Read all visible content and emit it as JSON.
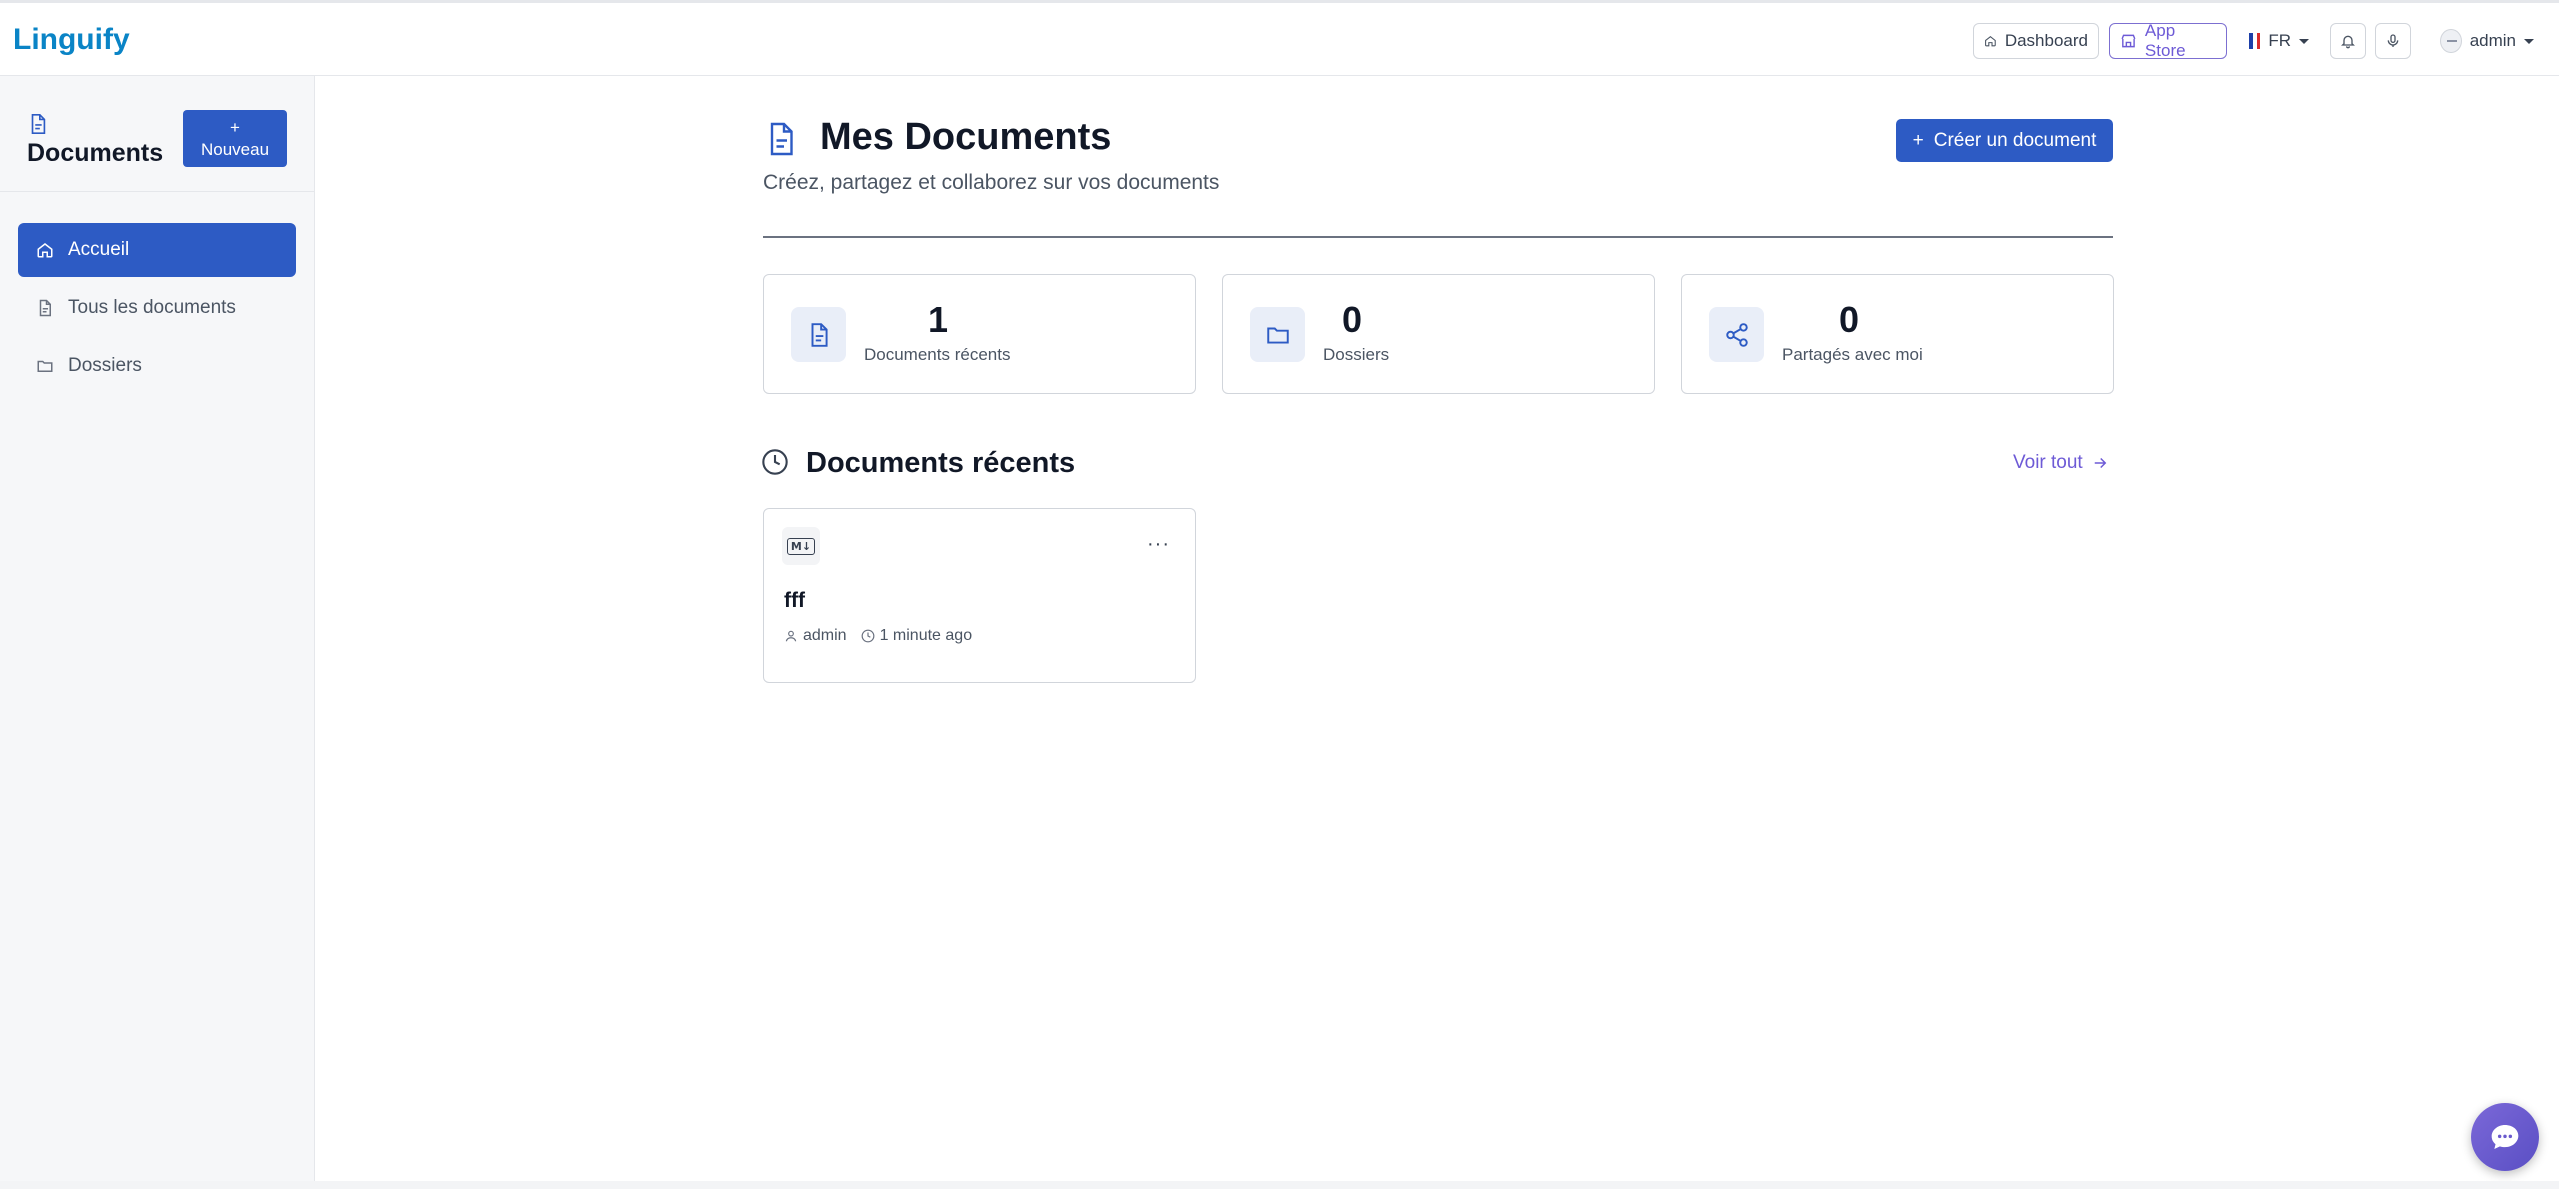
{
  "app": {
    "brand": "Linguify"
  },
  "header": {
    "dashboard_label": "Dashboard",
    "appstore_label": "App Store",
    "language": "FR",
    "user": "admin"
  },
  "sidebar": {
    "title": "Documents",
    "new_button": {
      "plus": "+",
      "label": "Nouveau"
    },
    "items": [
      {
        "label": "Accueil",
        "icon": "home-icon",
        "active": true
      },
      {
        "label": "Tous les documents",
        "icon": "document-icon",
        "active": false
      },
      {
        "label": "Dossiers",
        "icon": "folder-icon",
        "active": false
      }
    ]
  },
  "main": {
    "title": "Mes Documents",
    "subtitle": "Créez, partagez et collaborez sur vos documents",
    "create_button": {
      "plus": "+",
      "label": "Créer un document"
    },
    "stats": [
      {
        "value": "1",
        "label": "Documents récents",
        "icon": "document-icon"
      },
      {
        "value": "0",
        "label": "Dossiers",
        "icon": "folder-icon"
      },
      {
        "value": "0",
        "label": "Partagés avec moi",
        "icon": "share-icon"
      }
    ],
    "recent": {
      "title": "Documents récents",
      "see_all": "Voir tout",
      "documents": [
        {
          "badge": "M↓",
          "name": "fff",
          "author": "admin",
          "time": "1 minute ago"
        }
      ]
    }
  },
  "colors": {
    "brand": "#0a84c6",
    "primary": "#2d5bc4",
    "accent": "#6d5ad6"
  }
}
